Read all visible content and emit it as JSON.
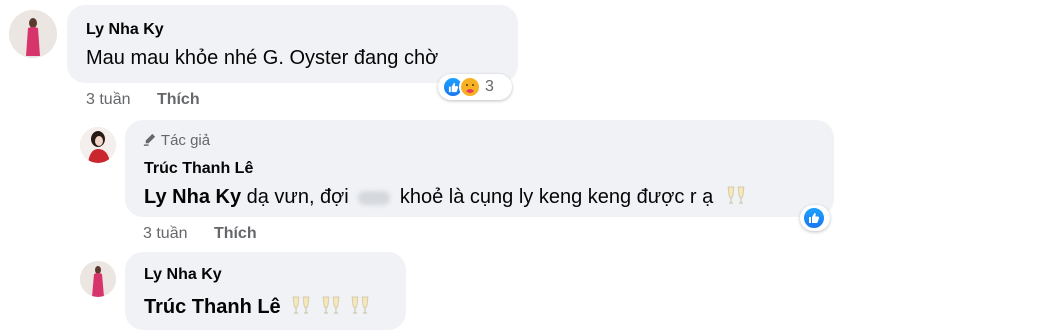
{
  "comments": [
    {
      "author": "Ly Nha Ky",
      "text": "Mau mau khỏe nhé G. Oyster đang chờ",
      "time": "3 tuần",
      "like_label": "Thích",
      "reaction_count": "3",
      "reaction_icons": [
        "like-icon",
        "care-icon"
      ]
    },
    {
      "author_badge": "Tác giả",
      "author": "Trúc Thanh Lê",
      "mention": "Ly Nha Ky",
      "text_part1": "dạ vưn, đợi",
      "text_part2": "khoẻ là cụng ly keng keng được r ạ",
      "time": "3 tuần",
      "like_label": "Thích",
      "reaction_icons": [
        "like-icon"
      ]
    },
    {
      "author": "Ly Nha Ky",
      "mention": "Trúc Thanh Lê",
      "emoji": "clinking-glasses-icon",
      "emoji_count": 3
    }
  ],
  "colors": {
    "bubble": "#f0f2f5",
    "like_blue": "#1877f2",
    "meta_gray": "#65676b",
    "text": "#050505"
  }
}
